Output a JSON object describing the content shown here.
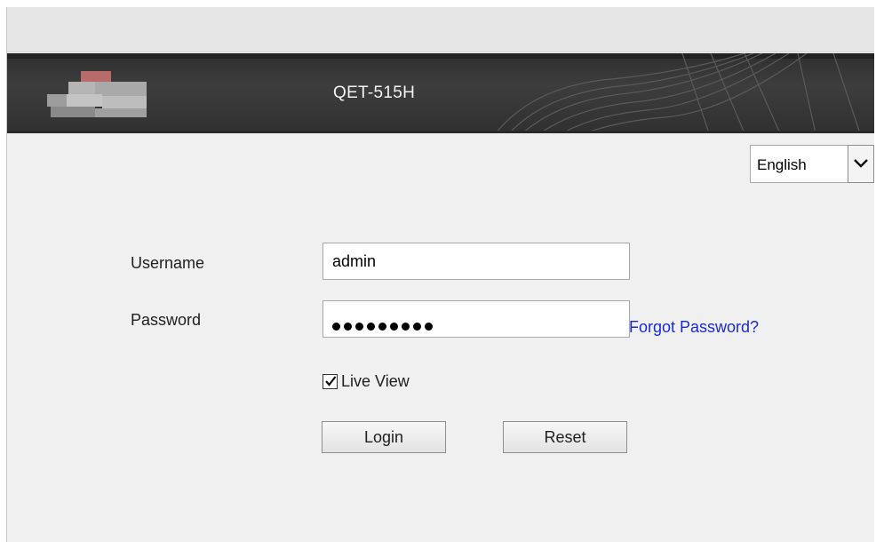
{
  "header": {
    "device_name": "QET-515H",
    "logo_icon": "brand-logo-icon"
  },
  "language": {
    "selected": "English",
    "icon": "chevron-down-icon"
  },
  "login_form": {
    "username_label": "Username",
    "username_value": "admin",
    "password_label": "Password",
    "password_length": 9,
    "forgot_link": "Forgot Password?",
    "live_view_label": "Live View",
    "live_view_checked": true,
    "login_button": "Login",
    "reset_button": "Reset"
  },
  "colors": {
    "header_bg": "#333333",
    "link": "#1a2bd6",
    "page_bg": "#f0f0f0"
  }
}
